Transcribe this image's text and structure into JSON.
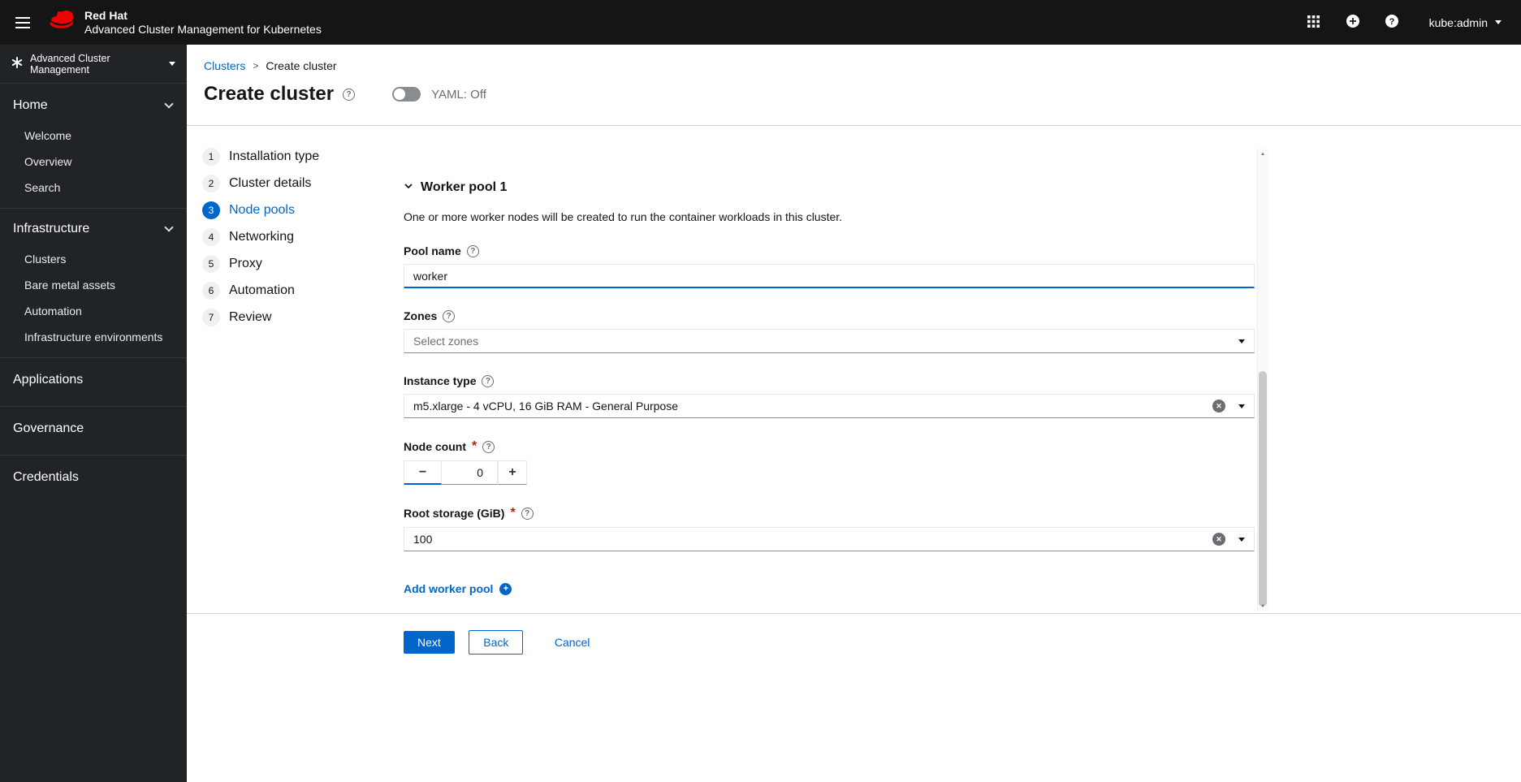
{
  "header": {
    "brand_title": "Red Hat",
    "brand_subtitle": "Advanced Cluster Management for Kubernetes",
    "user": "kube:admin"
  },
  "sidebar": {
    "perspective": "Advanced Cluster Management",
    "home": {
      "label": "Home",
      "items": [
        "Welcome",
        "Overview",
        "Search"
      ]
    },
    "infrastructure": {
      "label": "Infrastructure",
      "items": [
        "Clusters",
        "Bare metal assets",
        "Automation",
        "Infrastructure environments"
      ]
    },
    "items": [
      "Applications",
      "Governance",
      "Credentials"
    ]
  },
  "breadcrumb": {
    "items": [
      "Clusters",
      "Create cluster"
    ],
    "separator": ">"
  },
  "page": {
    "title": "Create cluster",
    "yaml_toggle_label": "YAML: Off",
    "yaml_toggle_state": "off"
  },
  "wizard": {
    "current_step": "Node pools",
    "steps": [
      {
        "num": "1",
        "label": "Installation type"
      },
      {
        "num": "2",
        "label": "Cluster details"
      },
      {
        "num": "3",
        "label": "Node pools"
      },
      {
        "num": "4",
        "label": "Networking"
      },
      {
        "num": "5",
        "label": "Proxy"
      },
      {
        "num": "6",
        "label": "Automation"
      },
      {
        "num": "7",
        "label": "Review"
      }
    ]
  },
  "form": {
    "section_title": "Worker pool 1",
    "section_description": "One or more worker nodes will be created to run the container workloads in this cluster.",
    "pool_name": {
      "label": "Pool name",
      "value": "worker"
    },
    "zones": {
      "label": "Zones",
      "placeholder": "Select zones"
    },
    "instance_type": {
      "label": "Instance type",
      "value": "m5.xlarge - 4 vCPU, 16 GiB RAM - General Purpose"
    },
    "node_count": {
      "label": "Node count",
      "value": "0"
    },
    "root_storage": {
      "label": "Root storage (GiB)",
      "value": "100"
    },
    "required_mark": "*",
    "add_worker_pool": "Add worker pool"
  },
  "footer": {
    "next": "Next",
    "back": "Back",
    "cancel": "Cancel"
  },
  "icons": {
    "help": "?",
    "clear": "✕",
    "minus": "−",
    "plus": "+",
    "scroll_up": "▲",
    "scroll_down": "▼"
  },
  "colors": {
    "primary": "#0066cc",
    "brand_red": "#ee0000",
    "header_bg": "#151515",
    "sidebar_bg": "#212427",
    "required": "#c9190b"
  }
}
